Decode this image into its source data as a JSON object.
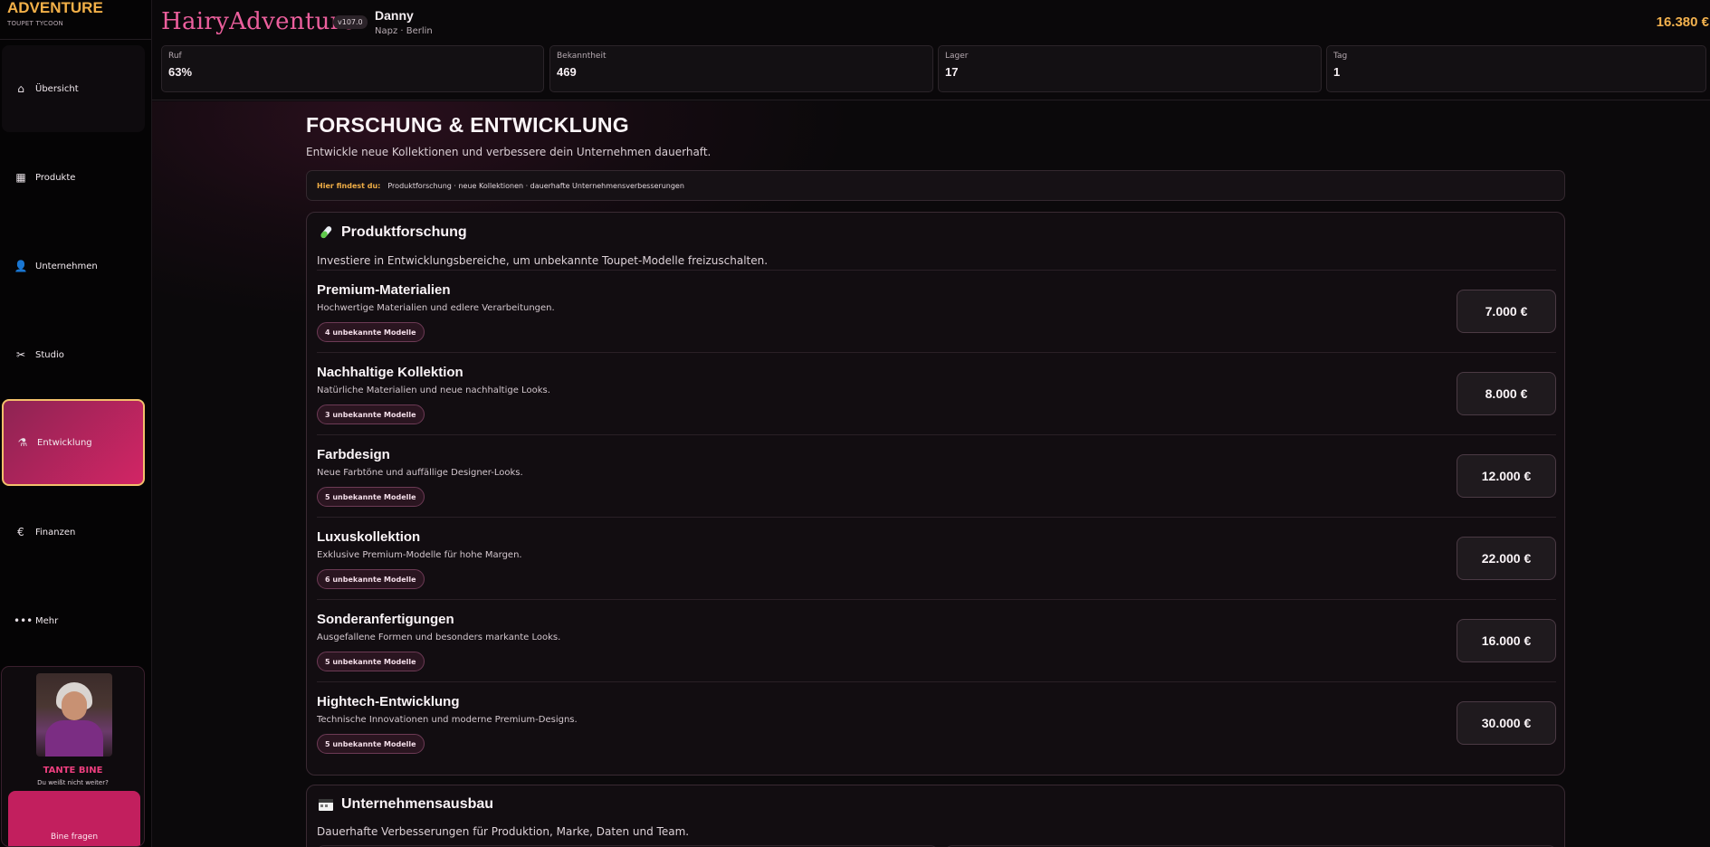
{
  "brand": {
    "title": "ADVENTURE",
    "subtitle": "TOUPET TYCOON"
  },
  "nav": [
    {
      "label": "Übersicht",
      "icon": "home-icon",
      "glyph": "⌂"
    },
    {
      "label": "Produkte",
      "icon": "grid-icon",
      "glyph": "▦"
    },
    {
      "label": "Unternehmen",
      "icon": "user-icon",
      "glyph": "👤"
    },
    {
      "label": "Studio",
      "icon": "scissors-icon",
      "glyph": "✂"
    },
    {
      "label": "Entwicklung",
      "icon": "flask-icon",
      "glyph": "⚗"
    },
    {
      "label": "Finanzen",
      "icon": "euro-icon",
      "glyph": "€"
    },
    {
      "label": "Mehr",
      "icon": "more-dots-icon",
      "glyph": "•••"
    }
  ],
  "helper": {
    "name": "TANTE BINE",
    "subtitle": "Du weißt nicht weiter?",
    "button": "Bine fragen"
  },
  "header": {
    "logo": "HairyAdventure",
    "version": "v107.0",
    "user_name": "Danny",
    "user_location": "Napz · Berlin",
    "money": "16.380 €"
  },
  "stats": [
    {
      "label": "Ruf",
      "value": "63%"
    },
    {
      "label": "Bekanntheit",
      "value": "469"
    },
    {
      "label": "Lager",
      "value": "17"
    },
    {
      "label": "Tag",
      "value": "1"
    }
  ],
  "page": {
    "title": "FORSCHUNG & ENTWICKLUNG",
    "subtitle": "Entwickle neue Kollektionen und verbessere dein Unternehmen dauerhaft.",
    "hint_key": "Hier findest du:",
    "hint_value": "Produktforschung · neue Kollektionen · dauerhafte Unternehmensverbesserungen"
  },
  "research": {
    "title": "Produktforschung",
    "description": "Investiere in Entwicklungsbereiche, um unbekannte Toupet-Modelle freizuschalten.",
    "items": [
      {
        "title": "Premium-Materialien",
        "description": "Hochwertige Materialien und edlere Verarbeitungen.",
        "badge": "4 unbekannte Modelle",
        "price": "7.000 €"
      },
      {
        "title": "Nachhaltige Kollektion",
        "description": "Natürliche Materialien und neue nachhaltige Looks.",
        "badge": "3 unbekannte Modelle",
        "price": "8.000 €"
      },
      {
        "title": "Farbdesign",
        "description": "Neue Farbtöne und auffällige Designer-Looks.",
        "badge": "5 unbekannte Modelle",
        "price": "12.000 €"
      },
      {
        "title": "Luxuskollektion",
        "description": "Exklusive Premium-Modelle für hohe Margen.",
        "badge": "6 unbekannte Modelle",
        "price": "22.000 €"
      },
      {
        "title": "Sonderanfertigungen",
        "description": "Ausgefallene Formen und besonders markante Looks.",
        "badge": "5 unbekannte Modelle",
        "price": "16.000 €"
      },
      {
        "title": "Hightech-Entwicklung",
        "description": "Technische Innovationen und moderne Premium-Designs.",
        "badge": "5 unbekannte Modelle",
        "price": "30.000 €"
      }
    ]
  },
  "expansion": {
    "title": "Unternehmensausbau",
    "description": "Dauerhafte Verbesserungen für Produktion, Marke, Daten und Team."
  }
}
